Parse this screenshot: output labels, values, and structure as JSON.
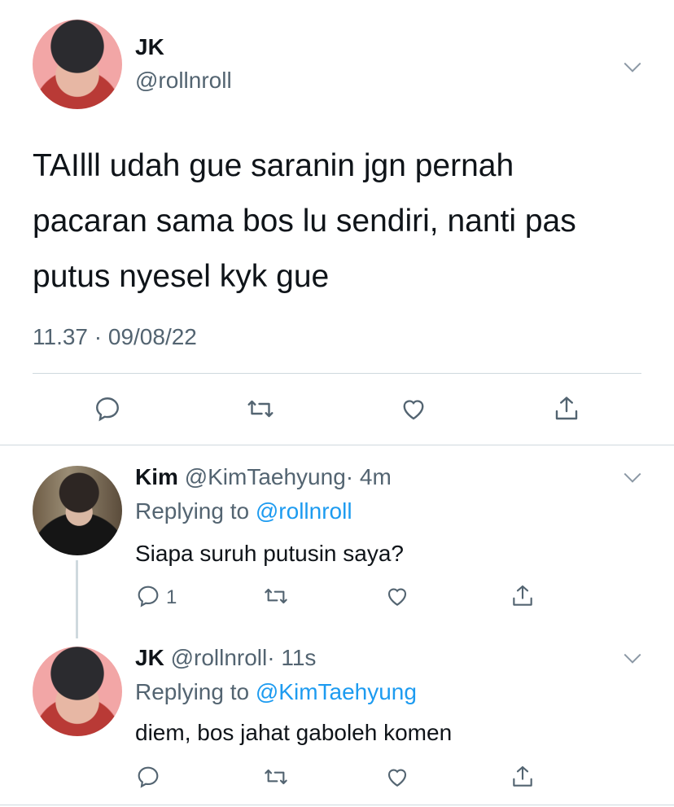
{
  "main_tweet": {
    "display_name": "JK",
    "handle": "@rollnroll",
    "text_line1": "TAIlll udah gue saranin jgn pernah",
    "text_line2": "pacaran sama bos lu sendiri, nanti pas",
    "text_line3": "putus nyesel kyk gue",
    "timestamp": "11.37 · 09/08/22"
  },
  "replies": [
    {
      "display_name": "Kim",
      "handle": "@KimTaehyung",
      "time": "· 4m",
      "replying_prefix": "Replying to",
      "replying_to": "@rollnroll",
      "text": "Siapa suruh putusin saya?",
      "reply_count": "1"
    },
    {
      "display_name": "JK",
      "handle": "@rollnroll",
      "time": "· 11s",
      "replying_prefix": "Replying to",
      "replying_to": "@KimTaehyung",
      "text": "diem, bos jahat gaboleh komen",
      "reply_count": ""
    }
  ],
  "icons": {
    "reply": "reply-icon",
    "retweet": "retweet-icon",
    "like": "heart-icon",
    "share": "share-icon",
    "more": "chevron-down-icon"
  },
  "colors": {
    "text": "#0f1419",
    "secondary": "#536471",
    "link": "#1d9bf0",
    "divider": "#cfd9de"
  }
}
